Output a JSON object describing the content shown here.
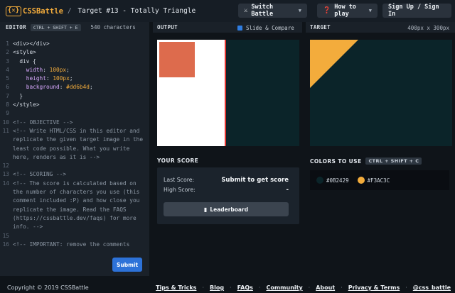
{
  "header": {
    "logo_mark": "{✕}",
    "logo_text": "CSSBattle",
    "target_title": "Target #13 - Totally Triangle",
    "switch_battle_label": "Switch Battle",
    "how_to_play_label": "How to play",
    "signup_label": "Sign Up / Sign In"
  },
  "editor_bar": {
    "title": "EDITOR",
    "shortcut": "CTRL + SHIFT + E",
    "chars": "540 characters"
  },
  "output_bar": {
    "title": "OUTPUT",
    "slide_compare": "Slide & Compare",
    "slide_compare_checked": true
  },
  "target_bar": {
    "title": "TARGET",
    "dimensions": "400px x 300px"
  },
  "editor": {
    "lines": [
      {
        "n": "1",
        "text": "<div></div>",
        "kind": "tag"
      },
      {
        "n": "2",
        "text": "<style>",
        "kind": "tag"
      },
      {
        "n": "3",
        "text": "  div {",
        "kind": "tag"
      },
      {
        "n": "4",
        "text": "    width: 100px;",
        "kind": "css",
        "prop": "width",
        "val": "100px"
      },
      {
        "n": "5",
        "text": "    height: 100px;",
        "kind": "css",
        "prop": "height",
        "val": "100px"
      },
      {
        "n": "6",
        "text": "    background: #dd6b4d;",
        "kind": "css",
        "prop": "background",
        "val": "#dd6b4d"
      },
      {
        "n": "7",
        "text": "  }",
        "kind": "tag"
      },
      {
        "n": "8",
        "text": "</style>",
        "kind": "tag"
      },
      {
        "n": "9",
        "text": "",
        "kind": "tag"
      },
      {
        "n": "10",
        "text": "<!-- OBJECTIVE -->",
        "kind": "comment"
      },
      {
        "n": "11",
        "text": "<!-- Write HTML/CSS in this editor and replicate the given target image in the least code possible. What you write here, renders as it is -->",
        "kind": "comment"
      },
      {
        "n": "12",
        "text": "",
        "kind": "tag"
      },
      {
        "n": "13",
        "text": "<!-- SCORING -->",
        "kind": "comment"
      },
      {
        "n": "14",
        "text": "<!-- The score is calculated based on the number of characters you use (this comment included :P) and how close you replicate the image. Read the FAQS (https://cssbattle.dev/faqs) for more info. -->",
        "kind": "comment"
      },
      {
        "n": "15",
        "text": "",
        "kind": "tag"
      },
      {
        "n": "16",
        "text": "<!-- IMPORTANT: remove the comments",
        "kind": "comment"
      }
    ],
    "submit_label": "Submit"
  },
  "output": {
    "square_color": "#dd6b4d",
    "background": "#ffffff"
  },
  "target": {
    "background": "#0B2429",
    "triangle_color": "#F3AC3C"
  },
  "score": {
    "title": "YOUR SCORE",
    "last_score_label": "Last Score:",
    "last_score_value": "Submit to get score",
    "high_score_label": "High Score:",
    "high_score_value": "-",
    "leaderboard_label": "Leaderboard"
  },
  "colors": {
    "title": "COLORS TO USE",
    "shortcut": "CTRL + SHIFT + C",
    "swatches": [
      {
        "hex": "#0B2429",
        "label": "#0B2429"
      },
      {
        "hex": "#F3AC3C",
        "label": "#F3AC3C"
      }
    ]
  },
  "footer": {
    "copyright": "Copyright © 2019 CSSBattle",
    "links": [
      "Tips & Tricks",
      "Blog",
      "FAQs",
      "Community",
      "About",
      "Privacy & Terms",
      "@css_battle"
    ]
  }
}
